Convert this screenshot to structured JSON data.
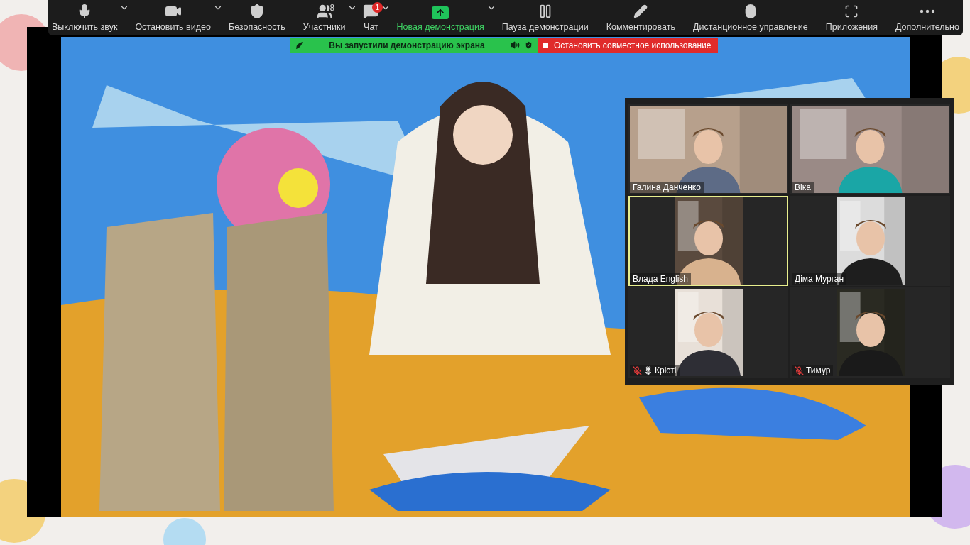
{
  "toolbar": {
    "items": [
      {
        "label": "Выключить звук",
        "caret": true,
        "highlighted": false
      },
      {
        "label": "Остановить видео",
        "caret": true,
        "highlighted": false
      },
      {
        "label": "Безопасность",
        "caret": false,
        "highlighted": false
      },
      {
        "label": "Участники",
        "caret": true,
        "highlighted": false,
        "count": "8"
      },
      {
        "label": "Чат",
        "caret": true,
        "highlighted": false,
        "badge": "1"
      },
      {
        "label": "Новая демонстрация",
        "caret": true,
        "highlighted": true
      },
      {
        "label": "Пауза демонстрации",
        "caret": false,
        "highlighted": false
      },
      {
        "label": "Комментировать",
        "caret": false,
        "highlighted": false
      },
      {
        "label": "Дистанционное управление",
        "caret": false,
        "highlighted": false
      },
      {
        "label": "Приложения",
        "caret": false,
        "highlighted": false
      },
      {
        "label": "Дополнительно",
        "caret": false,
        "highlighted": false
      }
    ]
  },
  "share_banner": {
    "status": "Вы запустили демонстрацию экрана",
    "stop": "Остановить совместное использование"
  },
  "gallery": {
    "tiles": [
      {
        "name": "Галина Данченко",
        "kind": "wide",
        "muted": false,
        "speaking": false
      },
      {
        "name": "Віка",
        "kind": "wide",
        "muted": false,
        "speaking": false
      },
      {
        "name": "Влада English",
        "kind": "portrait",
        "muted": false,
        "speaking": true
      },
      {
        "name": "Діма Мурган",
        "kind": "portrait",
        "muted": false,
        "speaking": false
      },
      {
        "name": "Крісті",
        "kind": "portrait",
        "muted": true,
        "speaking": false,
        "flower": true
      },
      {
        "name": "Тимур",
        "kind": "portrait",
        "muted": true,
        "speaking": false
      }
    ]
  }
}
